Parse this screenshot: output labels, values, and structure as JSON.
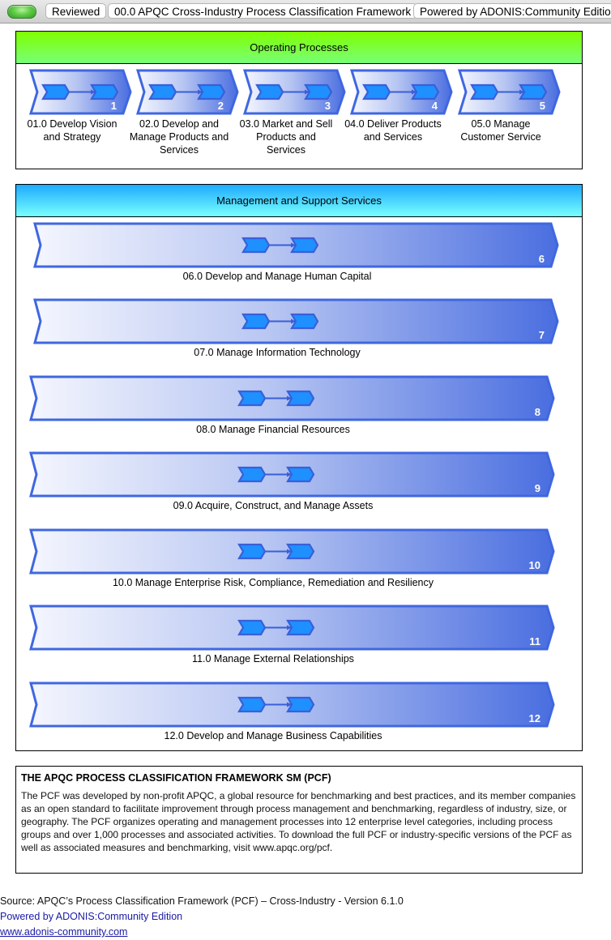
{
  "topbar": {
    "status_color": "#5fcc46",
    "pills": [
      "Reviewed",
      "00.0 APQC Cross-Industry Process Classification Framework",
      "Powered by ADONIS:Community Edition"
    ]
  },
  "colors": {
    "chevron_stroke": "#3f67e0",
    "chevron_dark": "#4a6ee0",
    "chevron_light": "#f4f6fe",
    "inner_fill": "#1e90ff",
    "op_header": [
      "#7fff00",
      "#78ff78"
    ],
    "ms_header": [
      "#1eaaff",
      "#78ffff"
    ]
  },
  "operating": {
    "title": "Operating Processes",
    "processes": [
      {
        "num": "1",
        "label": "01.0 Develop Vision and Strategy"
      },
      {
        "num": "2",
        "label": "02.0 Develop and Manage Products and Services"
      },
      {
        "num": "3",
        "label": "03.0 Market and Sell Products and Services"
      },
      {
        "num": "4",
        "label": "04.0 Deliver Products and Services"
      },
      {
        "num": "5",
        "label": "05.0 Manage Customer Service"
      }
    ]
  },
  "management": {
    "title": "Management and Support Services",
    "processes": [
      {
        "num": "6",
        "label": "06.0 Develop and Manage Human Capital"
      },
      {
        "num": "7",
        "label": "07.0 Manage Information Technology"
      },
      {
        "num": "8",
        "label": "08.0 Manage Financial Resources"
      },
      {
        "num": "9",
        "label": "09.0 Acquire, Construct, and Manage Assets"
      },
      {
        "num": "10",
        "label": "10.0 Manage Enterprise Risk, Compliance, Remediation and Resiliency"
      },
      {
        "num": "11",
        "label": "11.0 Manage External Relationships"
      },
      {
        "num": "12",
        "label": "12.0 Develop and Manage Business Capabilities"
      }
    ]
  },
  "info": {
    "title": "THE APQC PROCESS CLASSIFICATION FRAMEWORK SM  (PCF)",
    "body": "The PCF was developed by non-profit APQC, a global resource for benchmarking and best practices, and its member companies as an open standard to facilitate improvement through process management and benchmarking, regardless of industry, size, or geography. The PCF organizes operating and management processes into 12 enterprise level categories, including process groups and over 1,000 processes and associated activities. To download the full PCF or industry-specific versions of the PCF as well as associated measures and benchmarking, visit www.apqc.org/pcf."
  },
  "footer": {
    "source": "Source: APQC’s Process Classification Framework (PCF) – Cross-Industry - Version 6.1.0",
    "powered": "Powered by ADONIS:Community Edition",
    "url": "www.adonis-community.com"
  }
}
